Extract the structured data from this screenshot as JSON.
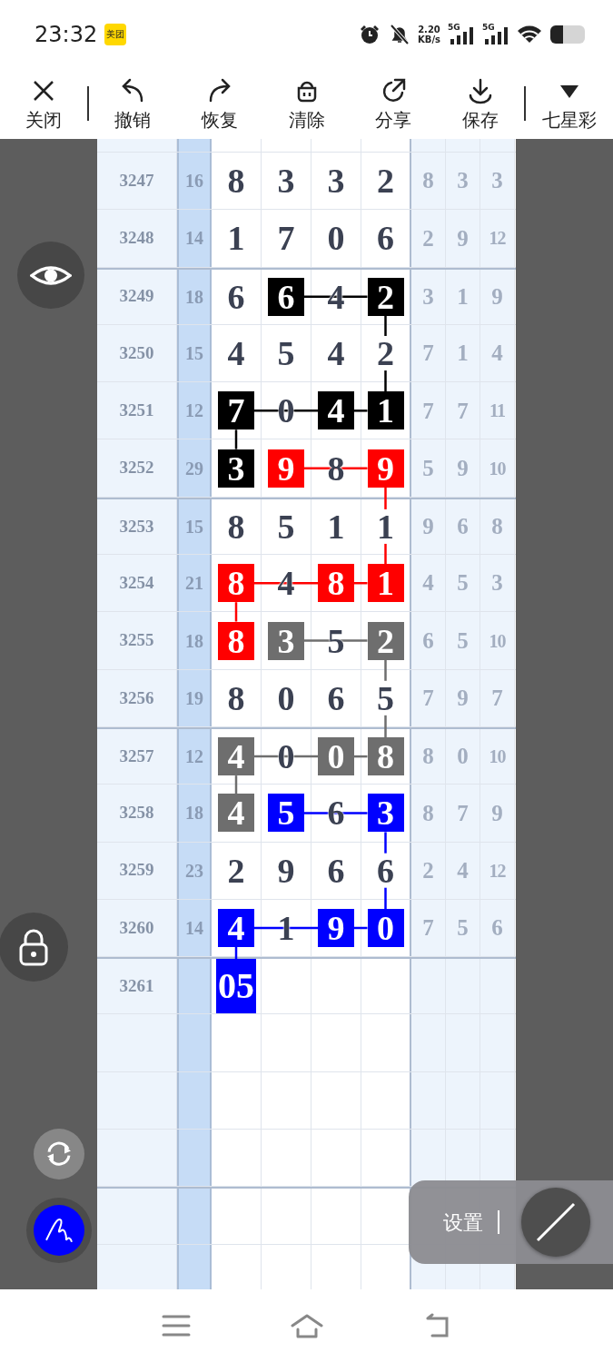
{
  "status_bar": {
    "time": "23:32",
    "app_badge": "美团",
    "net_speed": {
      "value": "2.20",
      "unit": "KB/s"
    },
    "signals": [
      {
        "label": "5G"
      },
      {
        "label": "5G"
      }
    ]
  },
  "toolbar": {
    "groups": [
      [
        {
          "kind": "close",
          "label": "关闭"
        }
      ],
      [
        {
          "kind": "undo",
          "label": "撤销"
        },
        {
          "kind": "redo",
          "label": "恢复"
        },
        {
          "kind": "clear",
          "label": "清除"
        },
        {
          "kind": "share",
          "label": "分享"
        },
        {
          "kind": "save",
          "label": "保存"
        }
      ],
      [
        {
          "kind": "dropdown",
          "label": "七星彩"
        }
      ]
    ]
  },
  "grid": {
    "rows": [
      {
        "issue": "3247",
        "sum": "16",
        "digits": [
          {
            "value": "8"
          },
          {
            "value": "3"
          },
          {
            "value": "3"
          },
          {
            "value": "2"
          }
        ],
        "tails": [
          "8",
          "3",
          "3"
        ]
      },
      {
        "issue": "3248",
        "sum": "14",
        "digits": [
          {
            "value": "1"
          },
          {
            "value": "7"
          },
          {
            "value": "0"
          },
          {
            "value": "6"
          }
        ],
        "tails": [
          "2",
          "9",
          "12"
        ]
      },
      {
        "issue": "3249",
        "sum": "18",
        "digits": [
          {
            "value": "6"
          },
          {
            "value": "6",
            "color": "#000000"
          },
          {
            "value": "4"
          },
          {
            "value": "2",
            "color": "#000000"
          }
        ],
        "tails": [
          "3",
          "1",
          "9"
        ]
      },
      {
        "issue": "3250",
        "sum": "15",
        "digits": [
          {
            "value": "4"
          },
          {
            "value": "5"
          },
          {
            "value": "4"
          },
          {
            "value": "2"
          }
        ],
        "tails": [
          "7",
          "1",
          "4"
        ]
      },
      {
        "issue": "3251",
        "sum": "12",
        "digits": [
          {
            "value": "7",
            "color": "#000000"
          },
          {
            "value": "0"
          },
          {
            "value": "4",
            "color": "#000000"
          },
          {
            "value": "1",
            "color": "#000000"
          }
        ],
        "tails": [
          "7",
          "7",
          "11"
        ]
      },
      {
        "issue": "3252",
        "sum": "29",
        "digits": [
          {
            "value": "3",
            "color": "#000000"
          },
          {
            "value": "9",
            "color": "#ff0000"
          },
          {
            "value": "8"
          },
          {
            "value": "9",
            "color": "#ff0000"
          }
        ],
        "tails": [
          "5",
          "9",
          "10"
        ]
      },
      {
        "issue": "3253",
        "sum": "15",
        "digits": [
          {
            "value": "8"
          },
          {
            "value": "5"
          },
          {
            "value": "1"
          },
          {
            "value": "1"
          }
        ],
        "tails": [
          "9",
          "6",
          "8"
        ]
      },
      {
        "issue": "3254",
        "sum": "21",
        "digits": [
          {
            "value": "8",
            "color": "#ff0000"
          },
          {
            "value": "4"
          },
          {
            "value": "8",
            "color": "#ff0000"
          },
          {
            "value": "1",
            "color": "#ff0000"
          }
        ],
        "tails": [
          "4",
          "5",
          "3"
        ]
      },
      {
        "issue": "3255",
        "sum": "18",
        "digits": [
          {
            "value": "8",
            "color": "#ff0000"
          },
          {
            "value": "3",
            "color": "#6e6e6e"
          },
          {
            "value": "5"
          },
          {
            "value": "2",
            "color": "#6e6e6e"
          }
        ],
        "tails": [
          "6",
          "5",
          "10"
        ]
      },
      {
        "issue": "3256",
        "sum": "19",
        "digits": [
          {
            "value": "8"
          },
          {
            "value": "0"
          },
          {
            "value": "6"
          },
          {
            "value": "5"
          }
        ],
        "tails": [
          "7",
          "9",
          "7"
        ]
      },
      {
        "issue": "3257",
        "sum": "12",
        "digits": [
          {
            "value": "4",
            "color": "#6e6e6e"
          },
          {
            "value": "0"
          },
          {
            "value": "0",
            "color": "#6e6e6e"
          },
          {
            "value": "8",
            "color": "#6e6e6e"
          }
        ],
        "tails": [
          "8",
          "0",
          "10"
        ]
      },
      {
        "issue": "3258",
        "sum": "18",
        "digits": [
          {
            "value": "4",
            "color": "#6e6e6e"
          },
          {
            "value": "5",
            "color": "#0000ff"
          },
          {
            "value": "6"
          },
          {
            "value": "3",
            "color": "#0000ff"
          }
        ],
        "tails": [
          "8",
          "7",
          "9"
        ]
      },
      {
        "issue": "3259",
        "sum": "23",
        "digits": [
          {
            "value": "2"
          },
          {
            "value": "9"
          },
          {
            "value": "6"
          },
          {
            "value": "6"
          }
        ],
        "tails": [
          "2",
          "4",
          "12"
        ]
      },
      {
        "issue": "3260",
        "sum": "14",
        "digits": [
          {
            "value": "4",
            "color": "#0000ff"
          },
          {
            "value": "1"
          },
          {
            "value": "9",
            "color": "#0000ff"
          },
          {
            "value": "0",
            "color": "#0000ff"
          }
        ],
        "tails": [
          "7",
          "5",
          "6"
        ]
      },
      {
        "issue": "3261",
        "digits": [
          {
            "value": "05",
            "color": "#0000ff"
          }
        ]
      }
    ]
  },
  "settings_panel": {
    "label": "设置"
  }
}
